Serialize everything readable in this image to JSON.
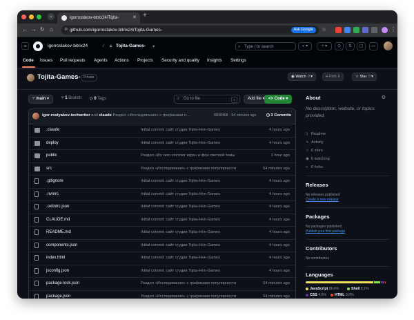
{
  "browser": {
    "tab_title": "igorroslakov-bitrix24/Tojita-",
    "url": "github.com/igorroslakov-bitrix24/Tojita-Games-",
    "ask_google": "Ask Google"
  },
  "header": {
    "owner": "igorroslakov-bitrix24",
    "separator": "/",
    "repo": "Tojita-Games-",
    "search_placeholder": "Type / to search"
  },
  "repo_nav": {
    "items": [
      "Code",
      "Issues",
      "Pull requests",
      "Agents",
      "Actions",
      "Projects",
      "Security and quality",
      "Insights",
      "Settings"
    ]
  },
  "repo": {
    "name": "Tojita-Games-",
    "visibility": "Private",
    "watch_label": "Watch",
    "watch_count": "0",
    "fork_label": "Fork",
    "fork_count": "0",
    "star_label": "Star",
    "star_count": "0"
  },
  "controls": {
    "branch": "main",
    "branches_count": "1",
    "branches_label": "Branch",
    "tags_count": "0",
    "tags_label": "Tags",
    "goto_placeholder": "Go to file",
    "goto_key": "t",
    "add_file": "Add file",
    "code": "Code"
  },
  "commit": {
    "author1": "igor-roslyakov-techwriter",
    "and": "and",
    "author2": "claude",
    "message": "Раздел «Исследования» с графиками п...",
    "hash": "8848468 · 54 minutes ago",
    "count": "3 Commits"
  },
  "files": [
    {
      "name": ".claude",
      "type": "dir",
      "message": "Initial commit: сайт студии Tojita-Hon-Games",
      "time": "4 hours ago"
    },
    {
      "name": "deploy",
      "type": "dir",
      "message": "Initial commit: сайт студии Tojita-Hon-Games",
      "time": "4 hours ago"
    },
    {
      "name": "public",
      "type": "dir",
      "message": "Раздел «Из чего состоит игра» и фон светлой темы",
      "time": "1 hour ago"
    },
    {
      "name": "src",
      "type": "dir",
      "message": "Раздел «Исследования» с графиками популярности",
      "time": "54 minutes ago"
    },
    {
      "name": ".gitignore",
      "type": "file",
      "message": "Initial commit: сайт студии Tojita-Hon-Games",
      "time": "4 hours ago"
    },
    {
      "name": ".nvmrc",
      "type": "file",
      "message": "Initial commit: сайт студии Tojita-Hon-Games",
      "time": "4 hours ago"
    },
    {
      "name": ".oxlintrc.json",
      "type": "file",
      "message": "Initial commit: сайт студии Tojita-Hon-Games",
      "time": "4 hours ago"
    },
    {
      "name": "CLAUDE.md",
      "type": "file",
      "message": "Initial commit: сайт студии Tojita-Hon-Games",
      "time": "4 hours ago"
    },
    {
      "name": "README.md",
      "type": "file",
      "message": "Initial commit: сайт студии Tojita-Hon-Games",
      "time": "4 hours ago"
    },
    {
      "name": "components.json",
      "type": "file",
      "message": "Initial commit: сайт студии Tojita-Hon-Games",
      "time": "4 hours ago"
    },
    {
      "name": "index.html",
      "type": "file",
      "message": "Initial commit: сайт студии Tojita-Hon-Games",
      "time": "4 hours ago"
    },
    {
      "name": "jsconfig.json",
      "type": "file",
      "message": "Initial commit: сайт студии Tojita-Hon-Games",
      "time": "4 hours ago"
    },
    {
      "name": "package-lock.json",
      "type": "file",
      "message": "Раздел «Исследования» с графиками популярности",
      "time": "54 minutes ago"
    },
    {
      "name": "package.json",
      "type": "file",
      "message": "Раздел «Исследования» с графиками популярности",
      "time": "54 minutes ago"
    }
  ],
  "sidebar": {
    "about_title": "About",
    "description": "No description, website, or topics provided.",
    "readme": "Readme",
    "activity": "Activity",
    "stars": "0 stars",
    "watching": "0 watching",
    "forks": "0 forks",
    "releases_title": "Releases",
    "releases_none": "No releases published",
    "releases_link": "Create a new release",
    "packages_title": "Packages",
    "packages_none": "No packages published",
    "packages_link": "Publish your first package",
    "contributors_title": "Contributors",
    "contributors_none": "No contributors",
    "languages_title": "Languages",
    "languages": [
      {
        "name": "JavaScript",
        "percent": "86.6%",
        "value": 86.6,
        "color": "#f1e05a"
      },
      {
        "name": "Shell",
        "percent": "8.1%",
        "value": 8.1,
        "color": "#89e051"
      },
      {
        "name": "CSS",
        "percent": "4.5%",
        "value": 4.5,
        "color": "#663399"
      },
      {
        "name": "HTML",
        "percent": "0.8%",
        "value": 0.8,
        "color": "#e34c26"
      }
    ]
  },
  "colors": {
    "accent_green": "#238636",
    "link_blue": "#4493f8",
    "underline_orange": "#f78166"
  }
}
